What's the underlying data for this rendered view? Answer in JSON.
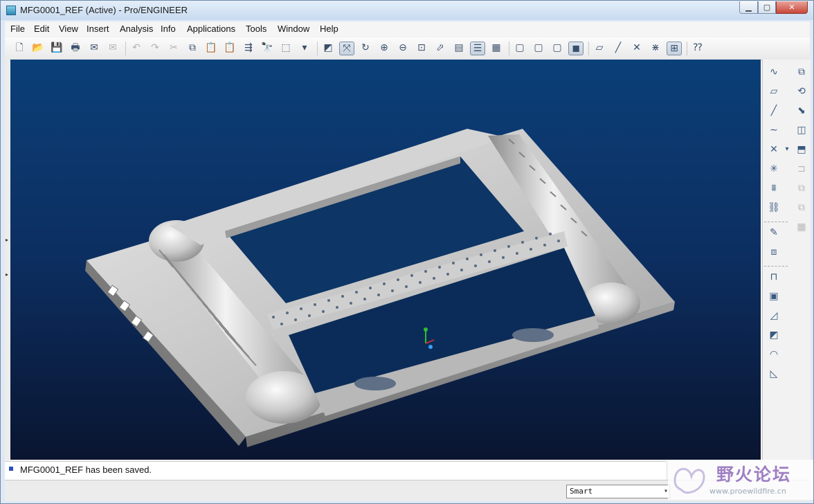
{
  "window": {
    "title": "MFG0001_REF (Active) - Pro/ENGINEER",
    "min_glyph": "▁",
    "max_glyph": "▢",
    "close_glyph": "✕"
  },
  "menubar": [
    "File",
    "Edit",
    "View",
    "Insert",
    "Analysis",
    "Info",
    "Applications",
    "Tools",
    "Window",
    "Help"
  ],
  "toolbar": [
    {
      "name": "new-file-icon",
      "glyph": "🗋"
    },
    {
      "name": "open-file-icon",
      "glyph": "📂"
    },
    {
      "name": "save-icon",
      "glyph": "💾"
    },
    {
      "name": "print-icon",
      "glyph": "🖶"
    },
    {
      "name": "send-email-icon",
      "glyph": "✉"
    },
    {
      "name": "send-link-icon",
      "glyph": "✉",
      "state": "dim"
    },
    {
      "sep": true
    },
    {
      "name": "undo-icon",
      "glyph": "↶",
      "state": "dim"
    },
    {
      "name": "redo-icon",
      "glyph": "↷",
      "state": "dim"
    },
    {
      "name": "cut-icon",
      "glyph": "✂",
      "state": "dim"
    },
    {
      "name": "copy-icon",
      "glyph": "⧉"
    },
    {
      "name": "paste-icon",
      "glyph": "📋"
    },
    {
      "name": "paste-special-icon",
      "glyph": "📋",
      "state": "dim"
    },
    {
      "name": "regenerate-icon",
      "glyph": "⇶"
    },
    {
      "name": "find-icon",
      "glyph": "🔭"
    },
    {
      "name": "select-box-icon",
      "glyph": "⬚"
    },
    {
      "name": "select-dropdown-icon",
      "glyph": "▾"
    },
    {
      "sep": true
    },
    {
      "name": "repaint-icon",
      "glyph": "◩"
    },
    {
      "name": "spin-center-icon",
      "glyph": "⤧",
      "state": "pressed"
    },
    {
      "name": "orient-mode-icon",
      "glyph": "↻"
    },
    {
      "name": "zoom-in-icon",
      "glyph": "⊕"
    },
    {
      "name": "zoom-out-icon",
      "glyph": "⊖"
    },
    {
      "name": "refit-icon",
      "glyph": "⊡"
    },
    {
      "name": "reorient-icon",
      "glyph": "⬀"
    },
    {
      "name": "saved-views-icon",
      "glyph": "▤"
    },
    {
      "name": "layers-icon",
      "glyph": "☰",
      "state": "pressed"
    },
    {
      "name": "view-manager-icon",
      "glyph": "▦"
    },
    {
      "sep": true
    },
    {
      "name": "wireframe-icon",
      "glyph": "▢"
    },
    {
      "name": "hidden-line-icon",
      "glyph": "▢"
    },
    {
      "name": "no-hidden-icon",
      "glyph": "▢"
    },
    {
      "name": "shading-icon",
      "glyph": "◼",
      "state": "pressed"
    },
    {
      "sep": true
    },
    {
      "name": "datum-planes-icon",
      "glyph": "▱"
    },
    {
      "name": "datum-axes-icon",
      "glyph": "╱"
    },
    {
      "name": "datum-points-icon",
      "glyph": "✕"
    },
    {
      "name": "coordinate-systems-icon",
      "glyph": "⋇"
    },
    {
      "name": "annotation-display-icon",
      "glyph": "⊞",
      "state": "pressed"
    },
    {
      "sep": true
    },
    {
      "name": "context-help-icon",
      "glyph": "⁇"
    }
  ],
  "right_panel": {
    "col1": [
      {
        "name": "sketch-tool-icon",
        "glyph": "∿"
      },
      {
        "name": "datum-plane-icon",
        "glyph": "▱"
      },
      {
        "name": "datum-axis-icon",
        "glyph": "╱"
      },
      {
        "name": "datum-curve-icon",
        "glyph": "∼"
      },
      {
        "name": "datum-point-icon",
        "glyph": "✕"
      },
      {
        "name": "datum-csys-icon",
        "glyph": "✳"
      },
      {
        "name": "analysis-feature-icon",
        "glyph": "⩩"
      },
      {
        "name": "chain-icon",
        "glyph": "⛓"
      },
      {
        "sep": true
      },
      {
        "name": "annotation-feature-icon",
        "glyph": "✎"
      },
      {
        "name": "workpiece-icon",
        "glyph": "⧈"
      },
      {
        "sep": true
      },
      {
        "name": "mill-window-icon",
        "glyph": "⊓"
      },
      {
        "name": "mill-surface-icon",
        "glyph": "▣"
      },
      {
        "name": "extrude-icon",
        "glyph": "◿"
      },
      {
        "name": "revolve-icon",
        "glyph": "◩"
      },
      {
        "name": "round-icon",
        "glyph": "◠"
      },
      {
        "name": "chamfer-icon",
        "glyph": "◺"
      }
    ],
    "col2": [
      {
        "name": "extrude-tool-icon",
        "glyph": "⧉"
      },
      {
        "name": "revolve-tool-icon",
        "glyph": "⟲"
      },
      {
        "name": "sweep-tool-icon",
        "glyph": "⬊"
      },
      {
        "name": "blend-tool-icon",
        "glyph": "◫"
      },
      {
        "name": "boundary-blend-icon",
        "glyph": "⬒"
      },
      {
        "name": "mirror-icon",
        "glyph": "⊐",
        "state": "dim"
      },
      {
        "name": "copy-feature-icon",
        "glyph": "⧉",
        "state": "dim"
      },
      {
        "name": "offset-icon",
        "glyph": "⧉",
        "state": "dim"
      },
      {
        "name": "pattern-icon",
        "glyph": "▦",
        "state": "dim"
      }
    ],
    "more_arrow": "▾"
  },
  "message": "MFG0001_REF has been saved.",
  "status": {
    "filter": "Smart",
    "filter_arrow": "▾"
  },
  "watermark": {
    "text": "野火论坛",
    "url": "www.proewildfire.cn"
  },
  "left_handle": {
    "arrow_up": "▸",
    "arrow_down": "▸"
  }
}
